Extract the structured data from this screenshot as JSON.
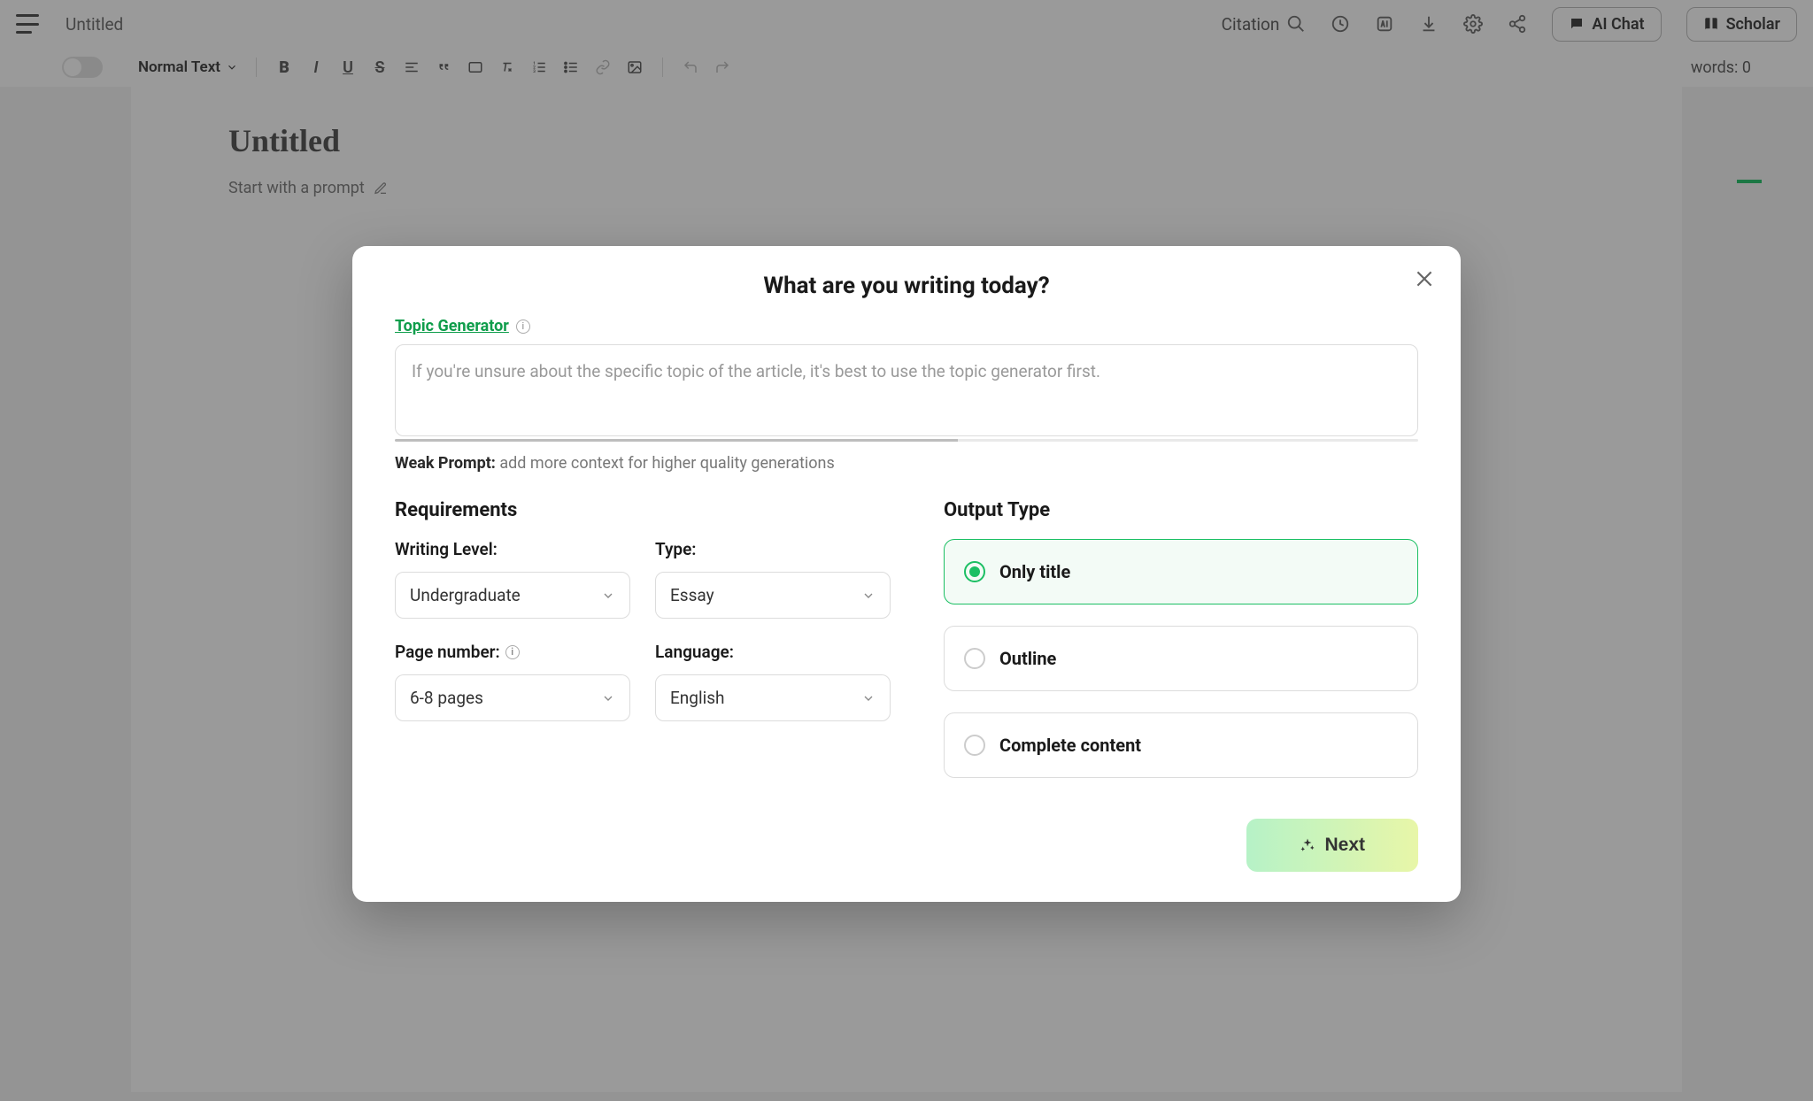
{
  "header": {
    "doc_title": "Untitled",
    "citation_label": "Citation",
    "ai_chat_label": "AI Chat",
    "scholar_label": "Scholar"
  },
  "toolbar": {
    "format_label": "Normal Text",
    "word_count_label": "words: 0"
  },
  "editor": {
    "title": "Untitled",
    "prompt_hint": "Start with a prompt"
  },
  "dialog": {
    "title": "What are you writing today?",
    "topic_generator_label": "Topic Generator",
    "topic_placeholder": "If you're unsure about the specific topic of the article, it's best to use the topic generator first.",
    "weak_prompt_label": "Weak Prompt:",
    "weak_prompt_hint": "add more context for higher quality generations",
    "requirements_title": "Requirements",
    "output_type_title": "Output Type",
    "fields": {
      "writing_level": {
        "label": "Writing Level:",
        "value": "Undergraduate"
      },
      "type": {
        "label": "Type:",
        "value": "Essay"
      },
      "page_number": {
        "label": "Page number:",
        "value": "6-8 pages"
      },
      "language": {
        "label": "Language:",
        "value": "English"
      }
    },
    "output_options": {
      "only_title": "Only title",
      "outline": "Outline",
      "complete_content": "Complete content"
    },
    "next_label": "Next"
  }
}
